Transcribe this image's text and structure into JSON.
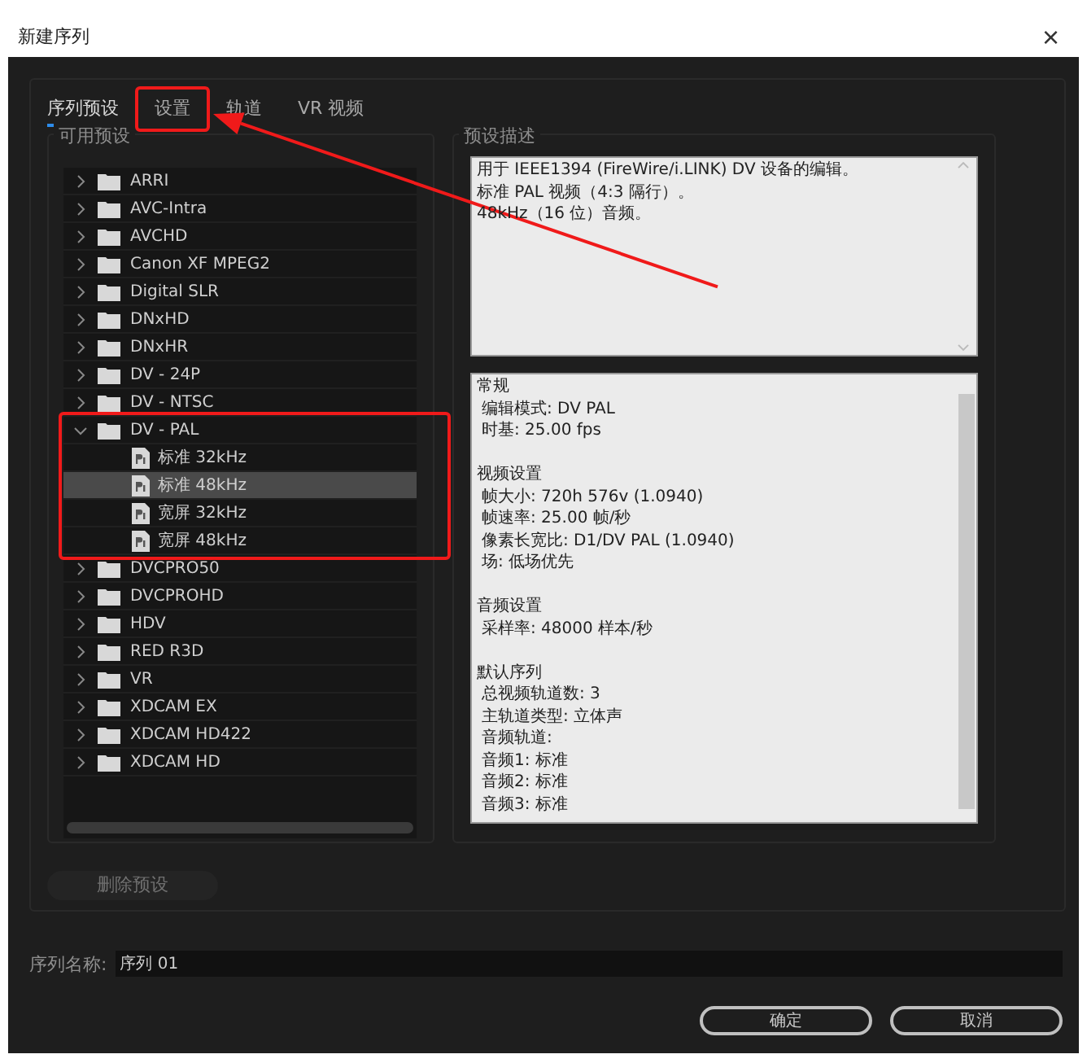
{
  "window": {
    "title": "新建序列",
    "close": "×"
  },
  "tabs": [
    {
      "label": "序列预设",
      "selected": true,
      "highlighted": false
    },
    {
      "label": "设置",
      "selected": false,
      "highlighted": true
    },
    {
      "label": "轨道",
      "selected": false,
      "highlighted": false
    },
    {
      "label": "VR 视频",
      "selected": false,
      "highlighted": false
    }
  ],
  "presets": {
    "title": "可用预设",
    "items": [
      {
        "kind": "folder",
        "label": "ARRI",
        "expanded": false
      },
      {
        "kind": "folder",
        "label": "AVC-Intra",
        "expanded": false
      },
      {
        "kind": "folder",
        "label": "AVCHD",
        "expanded": false
      },
      {
        "kind": "folder",
        "label": "Canon XF MPEG2",
        "expanded": false
      },
      {
        "kind": "folder",
        "label": "Digital SLR",
        "expanded": false
      },
      {
        "kind": "folder",
        "label": "DNxHD",
        "expanded": false
      },
      {
        "kind": "folder",
        "label": "DNxHR",
        "expanded": false
      },
      {
        "kind": "folder",
        "label": "DV - 24P",
        "expanded": false
      },
      {
        "kind": "folder",
        "label": "DV - NTSC",
        "expanded": false
      },
      {
        "kind": "folder",
        "label": "DV - PAL",
        "expanded": true,
        "highlighted": true,
        "children": [
          {
            "kind": "preset",
            "label": "标准 32kHz",
            "selected": false
          },
          {
            "kind": "preset",
            "label": "标准 48kHz",
            "selected": true
          },
          {
            "kind": "preset",
            "label": "宽屏 32kHz",
            "selected": false
          },
          {
            "kind": "preset",
            "label": "宽屏 48kHz",
            "selected": false
          }
        ]
      },
      {
        "kind": "folder",
        "label": "DVCPRO50",
        "expanded": false
      },
      {
        "kind": "folder",
        "label": "DVCPROHD",
        "expanded": false
      },
      {
        "kind": "folder",
        "label": "HDV",
        "expanded": false
      },
      {
        "kind": "folder",
        "label": "RED R3D",
        "expanded": false
      },
      {
        "kind": "folder",
        "label": "VR",
        "expanded": false
      },
      {
        "kind": "folder",
        "label": "XDCAM EX",
        "expanded": false
      },
      {
        "kind": "folder",
        "label": "XDCAM HD422",
        "expanded": false
      },
      {
        "kind": "folder",
        "label": "XDCAM HD",
        "expanded": false
      }
    ],
    "delete_button": {
      "label": "删除预设",
      "disabled": true
    }
  },
  "description": {
    "title": "预设描述",
    "lines": [
      "用于 IEEE1394 (FireWire/i.LINK) DV 设备的编辑。",
      "标准 PAL 视频（4:3 隔行）。",
      "48kHz（16 位）音频。"
    ]
  },
  "details": [
    {
      "heading": "常规",
      "lines": [
        "编辑模式: DV PAL",
        "时基: 25.00 fps"
      ]
    },
    {
      "heading": "视频设置",
      "lines": [
        "帧大小: 720h 576v (1.0940)",
        "帧速率: 25.00  帧/秒",
        "像素长宽比: D1/DV PAL (1.0940)",
        "场: 低场优先"
      ]
    },
    {
      "heading": "音频设置",
      "lines": [
        "采样率: 48000 样本/秒"
      ]
    },
    {
      "heading": "默认序列",
      "lines": [
        "总视频轨道数: 3",
        "主轨道类型: 立体声",
        "音频轨道:",
        "音频1: 标准",
        "音频2: 标准",
        "音频3: 标准"
      ]
    }
  ],
  "sequence_name": {
    "label": "序列名称:",
    "value": "序列 01"
  },
  "buttons": [
    {
      "label": "确定"
    },
    {
      "label": "取消"
    }
  ],
  "annotations": {
    "arrow": true
  }
}
